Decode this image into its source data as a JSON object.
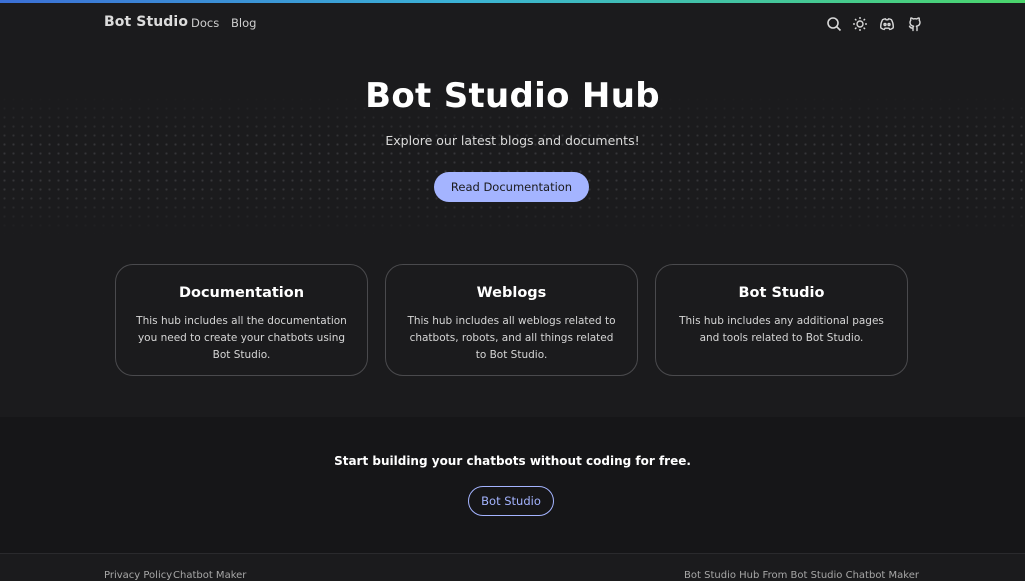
{
  "nav": {
    "brand": "Bot Studio",
    "links": [
      {
        "label": "Docs"
      },
      {
        "label": "Blog"
      }
    ],
    "icons": [
      "search-icon",
      "sun-icon",
      "discord-icon",
      "github-icon"
    ]
  },
  "hero": {
    "title": "Bot Studio Hub",
    "subtitle": "Explore our latest blogs and documents!",
    "cta_label": "Read Documentation"
  },
  "cards": [
    {
      "title": "Documentation",
      "desc": "This hub includes all the documentation you need to create your chatbots using Bot Studio."
    },
    {
      "title": "Weblogs",
      "desc": "This hub includes all weblogs related to chatbots, robots, and all things related to Bot Studio."
    },
    {
      "title": "Bot Studio",
      "desc": "This hub includes any additional pages and tools related to Bot Studio."
    }
  ],
  "band": {
    "text": "Start building your chatbots without coding for free.",
    "button_label": "Bot Studio"
  },
  "footer": {
    "privacy": "Privacy Policy",
    "maker": "Chatbot Maker",
    "right_text": "Bot Studio Hub From Bot Studio Chatbot Maker"
  },
  "colors": {
    "background": "#1b1b1d",
    "accent": "#a4b4ff",
    "band": "#161618"
  }
}
